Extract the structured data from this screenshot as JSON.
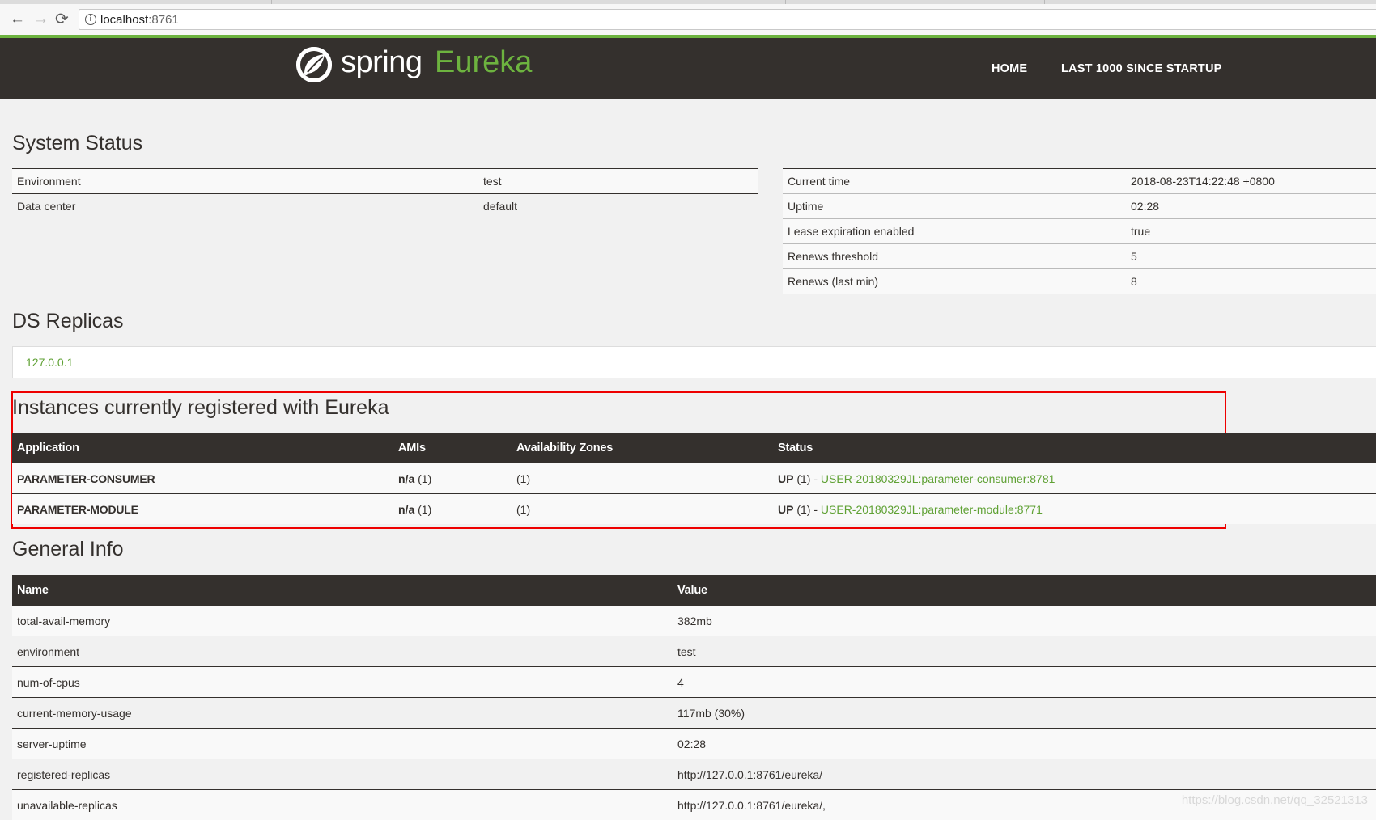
{
  "browser": {
    "url_host": "localhost",
    "url_port": ":8761",
    "back_glyph": "←",
    "forward_glyph": "→",
    "reload_glyph": "⟳",
    "info_glyph": "i"
  },
  "navbar": {
    "brand_spring": "spring",
    "brand_eureka": "Eureka",
    "links": [
      "HOME",
      "LAST 1000 SINCE STARTUP"
    ]
  },
  "system_status": {
    "title": "System Status",
    "left": [
      {
        "label": "Environment",
        "value": "test"
      },
      {
        "label": "Data center",
        "value": "default"
      }
    ],
    "right": [
      {
        "label": "Current time",
        "value": "2018-08-23T14:22:48 +0800"
      },
      {
        "label": "Uptime",
        "value": "02:28"
      },
      {
        "label": "Lease expiration enabled",
        "value": "true"
      },
      {
        "label": "Renews threshold",
        "value": "5"
      },
      {
        "label": "Renews (last min)",
        "value": "8"
      }
    ]
  },
  "ds_replicas": {
    "title": "DS Replicas",
    "items": [
      "127.0.0.1"
    ]
  },
  "instances": {
    "title": "Instances currently registered with Eureka",
    "columns": [
      "Application",
      "AMIs",
      "Availability Zones",
      "Status"
    ],
    "rows": [
      {
        "application": "PARAMETER-CONSUMER",
        "amis_bold": "n/a",
        "amis_count": " (1)",
        "zones": "(1)",
        "status_bold": "UP",
        "status_count": " (1) - ",
        "instance": "USER-20180329JL:parameter-consumer:8781"
      },
      {
        "application": "PARAMETER-MODULE",
        "amis_bold": "n/a",
        "amis_count": " (1)",
        "zones": "(1)",
        "status_bold": "UP",
        "status_count": " (1) - ",
        "instance": "USER-20180329JL:parameter-module:8771"
      }
    ]
  },
  "general_info": {
    "title": "General Info",
    "columns": [
      "Name",
      "Value"
    ],
    "rows": [
      {
        "name": "total-avail-memory",
        "value": "382mb"
      },
      {
        "name": "environment",
        "value": "test"
      },
      {
        "name": "num-of-cpus",
        "value": "4"
      },
      {
        "name": "current-memory-usage",
        "value": "117mb (30%)"
      },
      {
        "name": "server-uptime",
        "value": "02:28"
      },
      {
        "name": "registered-replicas",
        "value": "http://127.0.0.1:8761/eureka/"
      },
      {
        "name": "unavailable-replicas",
        "value": "http://127.0.0.1:8761/eureka/,"
      }
    ]
  },
  "watermark": "https://blog.csdn.net/qq_32521313",
  "colors": {
    "header_bg": "#34302d",
    "accent_green": "#6db33f",
    "link_green": "#5fa134",
    "highlight_red": "#e00000"
  }
}
